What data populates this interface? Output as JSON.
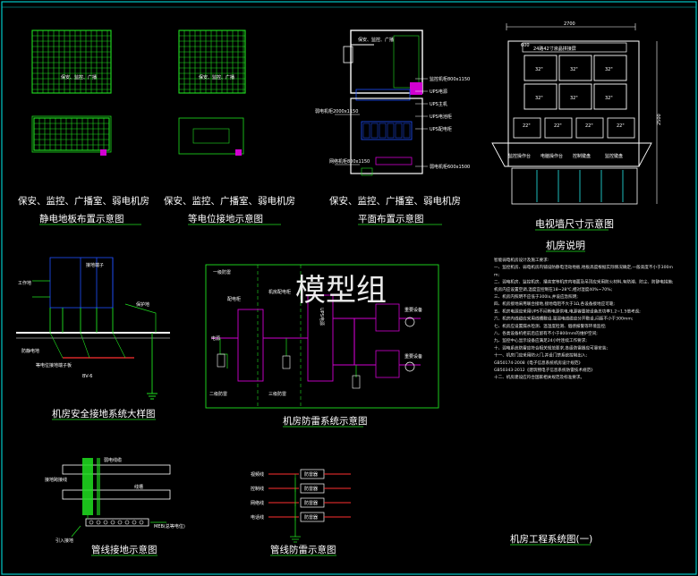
{
  "watermark": "模型组",
  "colors": {
    "background": "#000000",
    "green": "#20e020",
    "magenta": "#d000d0",
    "blue": "#2050ff",
    "cyan": "#20d0d0",
    "white": "#ffffff",
    "red": "#ff3030",
    "frame": "#00c8c8"
  },
  "panels": {
    "antistatic": {
      "title1": "保安、监控、广播室、弱电机房",
      "title2": "静电地板布置示意图",
      "room_label": "保安、监控、广播"
    },
    "equipotential": {
      "title1": "保安、监控、广播室、弱电机房",
      "title2": "等电位接地示意图",
      "room_label": "保安、监控、广播"
    },
    "floorplan": {
      "title1": "保安、监控、广播室、弱电机房",
      "title2": "平面布置示意图",
      "room_label": "保安、监控、广播",
      "callouts_right": [
        "监控机柜800x1150",
        "UPS电源",
        "UPS主机",
        "UPS电池柜",
        "UPS配电柜",
        "弱电机柜600x1500"
      ],
      "callouts_left": [
        "弱电机柜2000x1150",
        "网络机柜800x1150"
      ]
    },
    "videowall": {
      "title": "电视墙尺寸示意图",
      "dim_top": "2700",
      "dim_sub": "600",
      "header_label": "24路42寸液晶拼接屏",
      "dim_right": "2500",
      "screen_labels": [
        "32\"",
        "32\"",
        "32\"",
        "32\"",
        "32\"",
        "32\""
      ],
      "small_screens": [
        "22\"",
        "22\"",
        "22\"",
        "22\""
      ],
      "console_labels": [
        "监控操作台",
        "电脑操作台",
        "控制键盘",
        "监控键盘"
      ]
    },
    "grounding": {
      "title": "机房安全接地系统大样图",
      "labels": [
        "接地端子",
        "工作地",
        "保护地",
        "防静电地",
        "等电位接地端子板",
        "BV-6"
      ]
    },
    "lightning": {
      "title": "机房防雷系统示意图",
      "labels": [
        "一级防雷",
        "配电柜",
        "电源",
        "二级防雷",
        "UPS电源",
        "机房配电柜",
        "三级防雷",
        "重要设备",
        "重要设备"
      ]
    },
    "pipeground": {
      "title": "管线接地示意图",
      "labels": [
        "弱电线缆",
        "线槽",
        "接地跨接线",
        "MEB(总等电位)",
        "引入接地"
      ]
    },
    "pipesurge": {
      "title": "管线防雷示意图",
      "labels": [
        "视频线",
        "控制线",
        "网络线",
        "电话线"
      ],
      "device": "防雷器"
    },
    "description": {
      "title": "机房说明",
      "lines": [
        "智能弱电机房设计及施工要求:",
        "一、监控机房、弱电机房内铺设防静电活动地板,地板高度根据实际情况确定,一般高度不小于300mm;",
        "二、弱电机房、监控机房、播音室等机房内墙面及吊顶应采用防火材料,有防潮、防尘、防静电措施;",
        "机房内应设置空调,温度宜控制在18~28℃,相对湿度40%~70%;",
        "三、机房内照明不应低于300lx,并设应急照明;",
        "四、机房接地采用联合接地,接地电阻不大于1Ω,各设备接地应可靠;",
        "五、机房电源应采用UPS不间断电源供电,电源容量按设备总功率1.2~1.5倍考虑;",
        "六、机房内线缆应采用线槽敷设,强弱电线缆应分开敷设,间距不小于300mm;",
        "七、机房应设置漏水检测、温湿度检测、烟感报警等环境监控;",
        "八、各类设备机柜前后应留有不小于800mm的维护空间;",
        "九、监控中心显示设备应满足24小时连续工作要求;",
        "十、弱电系统防雷应符合相关规范要求,各级防雷器应可靠安装;",
        "十一、机房门应采用防火门,并设门禁系统控制出入;",
        "GB50174-2008《电子信息系统机房设计规范》",
        "GB50343-2012《建筑物电子信息系统防雷技术规范》",
        "十二、机房建设应符合国家相关规范及标准要求。"
      ],
      "footer": "机房工程系统图(一)"
    }
  }
}
